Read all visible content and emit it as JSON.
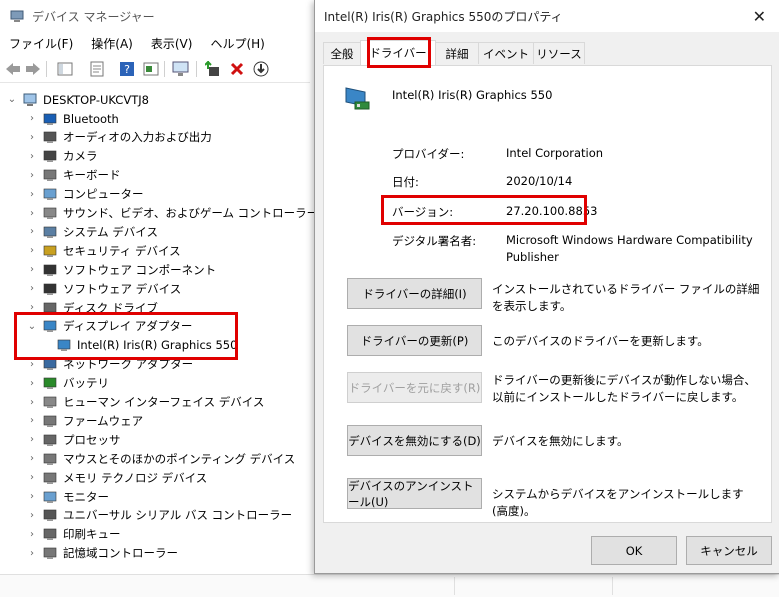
{
  "device_manager": {
    "title": "デバイス マネージャー",
    "menu": [
      "ファイル(F)",
      "操作(A)",
      "表示(V)",
      "ヘルプ(H)"
    ],
    "root": "DESKTOP-UKCVTJ8",
    "tree": [
      {
        "label": "Bluetooth",
        "icon": "bluetooth-icon",
        "expanded": false
      },
      {
        "label": "オーディオの入力および出力",
        "icon": "speaker-icon",
        "expanded": false
      },
      {
        "label": "カメラ",
        "icon": "camera-icon",
        "expanded": false
      },
      {
        "label": "キーボード",
        "icon": "keyboard-icon",
        "expanded": false
      },
      {
        "label": "コンピューター",
        "icon": "computer-icon",
        "expanded": false
      },
      {
        "label": "サウンド、ビデオ、およびゲーム コントローラー",
        "icon": "sound-icon",
        "expanded": false
      },
      {
        "label": "システム デバイス",
        "icon": "system-device-icon",
        "expanded": false
      },
      {
        "label": "セキュリティ デバイス",
        "icon": "security-device-icon",
        "expanded": false
      },
      {
        "label": "ソフトウェア コンポーネント",
        "icon": "software-component-icon",
        "expanded": false
      },
      {
        "label": "ソフトウェア デバイス",
        "icon": "software-device-icon",
        "expanded": false
      },
      {
        "label": "ディスク ドライブ",
        "icon": "disk-drive-icon",
        "expanded": false
      },
      {
        "label": "ディスプレイ アダプター",
        "icon": "display-adapter-icon",
        "expanded": true
      },
      {
        "label": "Intel(R) Iris(R) Graphics 550",
        "icon": "display-adapter-icon",
        "child": true
      },
      {
        "label": "ネットワーク アダプター",
        "icon": "network-adapter-icon",
        "expanded": false
      },
      {
        "label": "バッテリ",
        "icon": "battery-icon",
        "expanded": false
      },
      {
        "label": "ヒューマン インターフェイス デバイス",
        "icon": "hid-icon",
        "expanded": false
      },
      {
        "label": "ファームウェア",
        "icon": "firmware-icon",
        "expanded": false
      },
      {
        "label": "プロセッサ",
        "icon": "processor-icon",
        "expanded": false
      },
      {
        "label": "マウスとそのほかのポインティング デバイス",
        "icon": "mouse-icon",
        "expanded": false
      },
      {
        "label": "メモリ テクノロジ デバイス",
        "icon": "memory-icon",
        "expanded": false
      },
      {
        "label": "モニター",
        "icon": "monitor-icon",
        "expanded": false
      },
      {
        "label": "ユニバーサル シリアル バス コントローラー",
        "icon": "usb-icon",
        "expanded": false
      },
      {
        "label": "印刷キュー",
        "icon": "print-queue-icon",
        "expanded": false
      },
      {
        "label": "記憶域コントローラー",
        "icon": "storage-controller-icon",
        "expanded": false
      }
    ]
  },
  "dialog": {
    "title": "Intel(R) Iris(R) Graphics 550のプロパティ",
    "close": "✕",
    "tabs": [
      "全般",
      "ドライバー",
      "詳細",
      "イベント",
      "リソース"
    ],
    "active_tab": "ドライバー",
    "device_name": "Intel(R) Iris(R) Graphics 550",
    "fields": {
      "provider_label": "プロバイダー:",
      "provider_value": "Intel Corporation",
      "date_label": "日付:",
      "date_value": "2020/10/14",
      "version_label": "バージョン:",
      "version_value": "27.20.100.8853",
      "signer_label": "デジタル署名者:",
      "signer_value_line1": "Microsoft Windows Hardware Compatibility",
      "signer_value_line2": "Publisher"
    },
    "actions": [
      {
        "button": "ドライバーの詳細(I)",
        "description": "インストールされているドライバー ファイルの詳細を表示します。",
        "enabled": true
      },
      {
        "button": "ドライバーの更新(P)",
        "description": "このデバイスのドライバーを更新します。",
        "enabled": true
      },
      {
        "button": "ドライバーを元に戻す(R)",
        "description": "ドライバーの更新後にデバイスが動作しない場合、以前にインストールしたドライバーに戻します。",
        "enabled": false
      },
      {
        "button": "デバイスを無効にする(D)",
        "description": "デバイスを無効にします。",
        "enabled": true
      },
      {
        "button": "デバイスのアンインストール(U)",
        "description": "システムからデバイスをアンインストールします (高度)。",
        "enabled": true
      }
    ],
    "ok_label": "OK",
    "cancel_label": "キャンセル"
  },
  "colors": {
    "highlight": "#e00000",
    "accent": "#0a64c8"
  }
}
